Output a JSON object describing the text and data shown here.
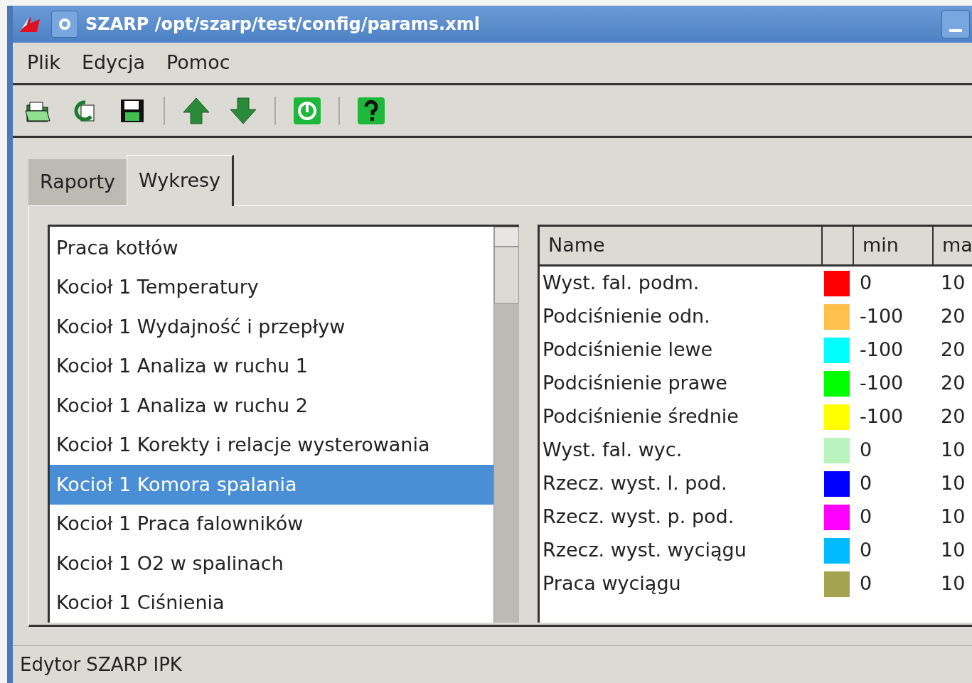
{
  "window": {
    "title": "SZARP /opt/szarp/test/config/params.xml"
  },
  "menu": [
    "Plik",
    "Edycja",
    "Pomoc"
  ],
  "tabs": [
    {
      "label": "Raporty",
      "selected": false
    },
    {
      "label": "Wykresy",
      "selected": true
    }
  ],
  "list": [
    {
      "label": "Praca kotłów",
      "selected": false
    },
    {
      "label": "Kocioł 1 Temperatury",
      "selected": false
    },
    {
      "label": "Kocioł 1 Wydajność i przepływ",
      "selected": false
    },
    {
      "label": "Kocioł 1 Analiza w ruchu 1",
      "selected": false
    },
    {
      "label": "Kocioł 1 Analiza w ruchu 2",
      "selected": false
    },
    {
      "label": "Kocioł 1 Korekty i relacje wysterowania",
      "selected": false
    },
    {
      "label": "Kocioł 1 Komora spalania",
      "selected": true
    },
    {
      "label": "Kocioł 1 Praca falowników",
      "selected": false
    },
    {
      "label": "Kocioł 1 O2 w spalinach",
      "selected": false
    },
    {
      "label": "Kocioł 1 Ciśnienia",
      "selected": false
    }
  ],
  "table": {
    "columns": [
      "Name",
      "min",
      "ma"
    ],
    "rows": [
      {
        "name": "Wyst. fal. podm.",
        "color": "#ff0000",
        "min": "0",
        "max": "10"
      },
      {
        "name": "Podciśnienie odn.",
        "color": "#ffc04c",
        "min": "-100",
        "max": "20"
      },
      {
        "name": "Podciśnienie lewe",
        "color": "#00ffff",
        "min": "-100",
        "max": "20"
      },
      {
        "name": "Podciśnienie prawe",
        "color": "#00ff00",
        "min": "-100",
        "max": "20"
      },
      {
        "name": "Podciśnienie średnie",
        "color": "#ffff00",
        "min": "-100",
        "max": "20"
      },
      {
        "name": "Wyst. fal. wyc.",
        "color": "#b8f4bc",
        "min": "0",
        "max": "10"
      },
      {
        "name": "Rzecz. wyst. l. pod.",
        "color": "#0000ff",
        "min": "0",
        "max": "10"
      },
      {
        "name": "Rzecz. wyst. p. pod.",
        "color": "#ff00ff",
        "min": "0",
        "max": "10"
      },
      {
        "name": "Rzecz. wyst. wyciągu",
        "color": "#00bbff",
        "min": "0",
        "max": "10"
      },
      {
        "name": "Praca wyciągu",
        "color": "#a4a450",
        "min": "0",
        "max": "10"
      }
    ]
  },
  "status_bar": "Edytor SZARP IPK"
}
